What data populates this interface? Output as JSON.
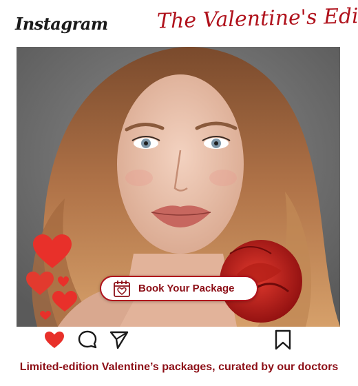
{
  "header": {
    "logo_text": "Instagram",
    "headline": "The Valentine's Edit!"
  },
  "post": {
    "cta_label": "Book Your Package",
    "cta_icon": "calendar-heart-icon",
    "caption": "Limited-edition Valentine’s packages, curated by our doctors"
  },
  "actions": {
    "like_icon": "heart-icon",
    "comment_icon": "comment-icon",
    "share_icon": "send-icon",
    "save_icon": "bookmark-icon"
  },
  "colors": {
    "accent": "#b0121c",
    "caption": "#8c0e16",
    "heart": "#e8302a"
  }
}
